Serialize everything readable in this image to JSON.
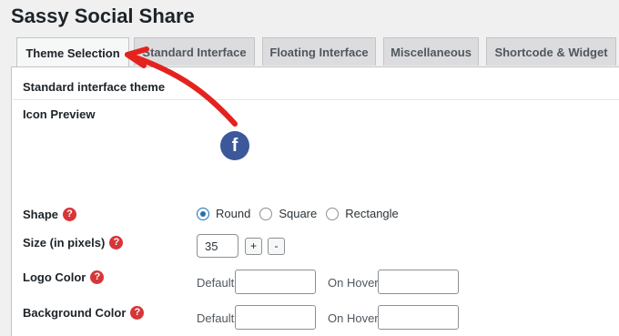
{
  "page_title": "Sassy Social Share",
  "tabs": [
    {
      "label": "Theme Selection",
      "active": true
    },
    {
      "label": "Standard Interface",
      "active": false
    },
    {
      "label": "Floating Interface",
      "active": false
    },
    {
      "label": "Miscellaneous",
      "active": false
    },
    {
      "label": "Shortcode & Widget",
      "active": false
    }
  ],
  "section_heading": "Standard interface theme",
  "icon_preview": {
    "label": "Icon Preview",
    "icon": "facebook-icon",
    "glyph": "f"
  },
  "shape": {
    "label": "Shape",
    "options": [
      "Round",
      "Square",
      "Rectangle"
    ],
    "selected": "Round"
  },
  "size": {
    "label": "Size (in pixels)",
    "value": "35",
    "plus": "+",
    "minus": "-"
  },
  "logo_color": {
    "label": "Logo Color",
    "default_label": "Default",
    "hover_label": "On Hover"
  },
  "background_color": {
    "label": "Background Color",
    "default_label": "Default",
    "hover_label": "On Hover"
  },
  "help_glyph": "?",
  "colors": {
    "accent": "#2271b1",
    "help": "#d63638",
    "facebook": "#3c589a",
    "annotation": "#e4231f"
  }
}
